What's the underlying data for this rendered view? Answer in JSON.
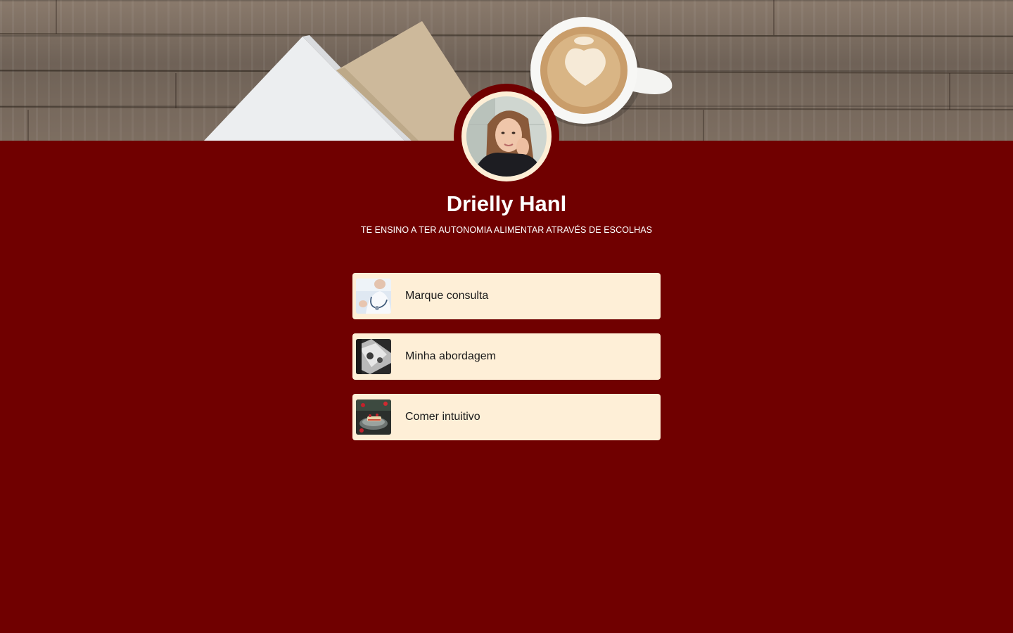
{
  "profile": {
    "name": "Drielly Hanl",
    "bio": "TE ENSINO A TER AUTONOMIA ALIMENTAR ATRAVÉS DE ESCOLHAS"
  },
  "links": [
    {
      "label": "Marque consulta",
      "thumb": "doctor-stethoscope-thumbnail"
    },
    {
      "label": "Minha abordagem",
      "thumb": "approach-thumbnail"
    },
    {
      "label": "Comer intuitivo",
      "thumb": "food-plate-thumbnail"
    }
  ],
  "colors": {
    "background": "#700000",
    "card": "#feefd7",
    "text": "#ffffff"
  }
}
